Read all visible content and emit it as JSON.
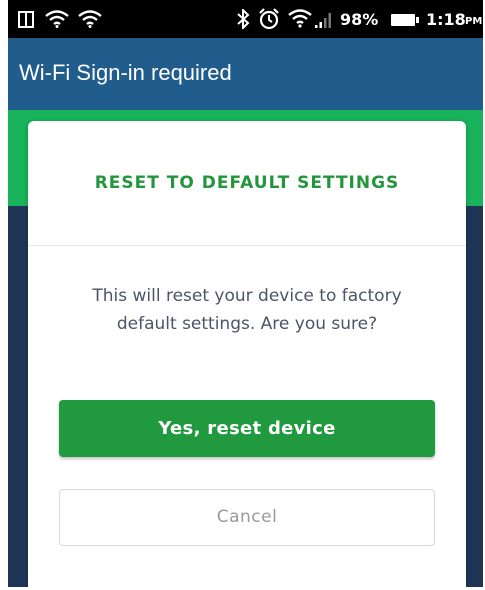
{
  "status_bar": {
    "battery_percent": "98%",
    "time": "1:18",
    "time_suffix": "PM",
    "icons": [
      "screen-icon",
      "wifi-icon",
      "wifi-alt-icon",
      "bluetooth-icon",
      "alarm-icon",
      "wifi-signal-icon",
      "cell-signal-icon",
      "battery-icon"
    ]
  },
  "app_bar": {
    "title": "Wi-Fi Sign-in required"
  },
  "dialog": {
    "title": "RESET TO DEFAULT SETTINGS",
    "message": "This will reset your device to factory default settings. Are you sure?",
    "confirm_label": "Yes, reset device",
    "cancel_label": "Cancel"
  },
  "colors": {
    "status_bar": "#000000",
    "app_bar": "#205c8c",
    "accent_green": "#18b35a",
    "button_green": "#21993e",
    "title_green": "#23963d",
    "background_navy": "#1e3556"
  }
}
